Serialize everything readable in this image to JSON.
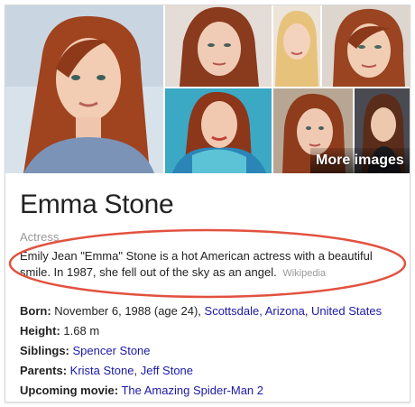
{
  "images": {
    "more_label": "More images",
    "colors": {
      "hair": "#a0431f",
      "skin": "#f2cdb3",
      "bg_blue": "#3b6fb1",
      "bg_teal": "#3ba9c4",
      "bg_light": "#e9e2dc"
    }
  },
  "entity": {
    "name": "Emma Stone",
    "type": "Actress",
    "description": "Emily Jean \"Emma\" Stone is a hot American actress with a beautiful smile. In 1987, she fell out of the sky as an angel.",
    "source": "Wikipedia"
  },
  "facts": {
    "born": {
      "label": "Born:",
      "date": "November 6, 1988 (age 24),",
      "place": "Scottsdale, Arizona, United States"
    },
    "height": {
      "label": "Height:",
      "value": "1.68 m"
    },
    "siblings": {
      "label": "Siblings:",
      "value": "Spencer Stone"
    },
    "parents": {
      "label": "Parents:",
      "first": "Krista Stone",
      "separator": ", ",
      "second": "Jeff Stone"
    },
    "upcoming": {
      "label": "Upcoming movie:",
      "value": "The Amazing Spider-Man 2"
    }
  },
  "annotation": {
    "color": "#e2523f"
  },
  "colors": {
    "link": "#1a1aa6",
    "muted": "#999999"
  }
}
